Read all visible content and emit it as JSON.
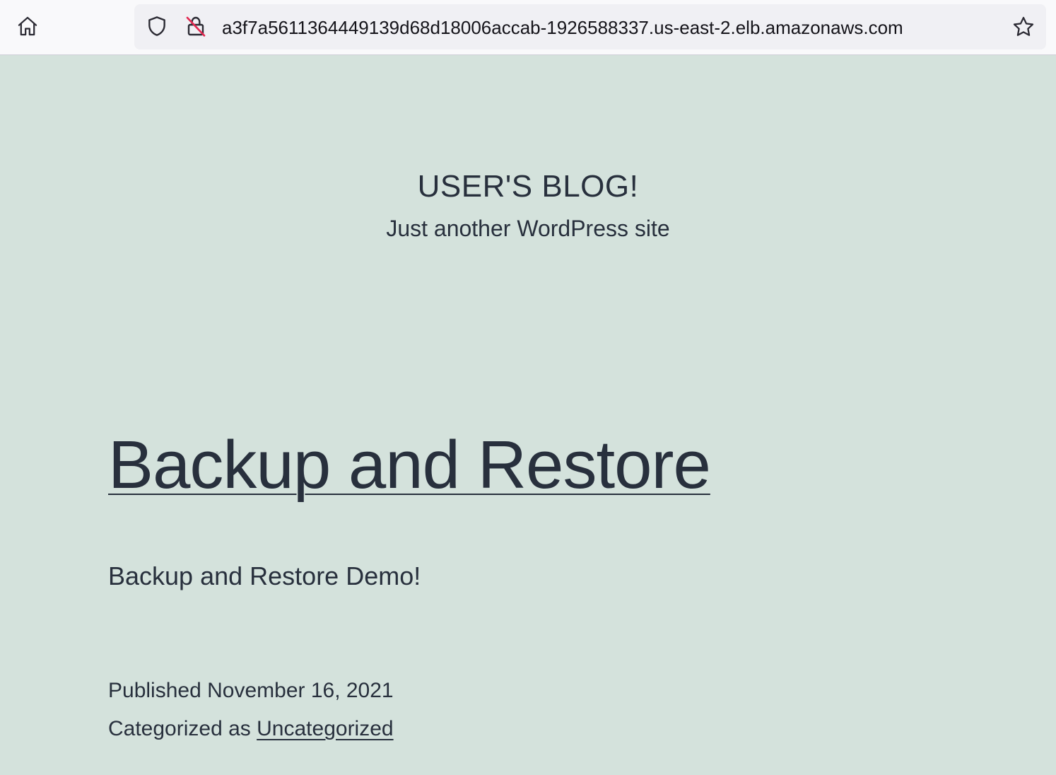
{
  "browser": {
    "url": "a3f7a5611364449139d68d18006accab-1926588337.us-east-2.elb.amazonaws.com",
    "icons": {
      "home": "home-icon",
      "shield": "shield-icon",
      "lock": "insecure-lock-icon",
      "star": "star-icon"
    }
  },
  "site": {
    "title": "USER'S BLOG!",
    "description": "Just another WordPress site"
  },
  "post": {
    "title": "Backup and Restore",
    "content": "Backup and Restore Demo!",
    "published_label": "Published",
    "published_date": "November 16, 2021",
    "category_label": "Categorized as",
    "category": "Uncategorized"
  },
  "colors": {
    "page_background": "#d4e2dc",
    "text": "#28303d",
    "toolbar": "#f9f9fb",
    "urlbar": "#f0f0f4",
    "insecure_slash": "#e22850"
  }
}
